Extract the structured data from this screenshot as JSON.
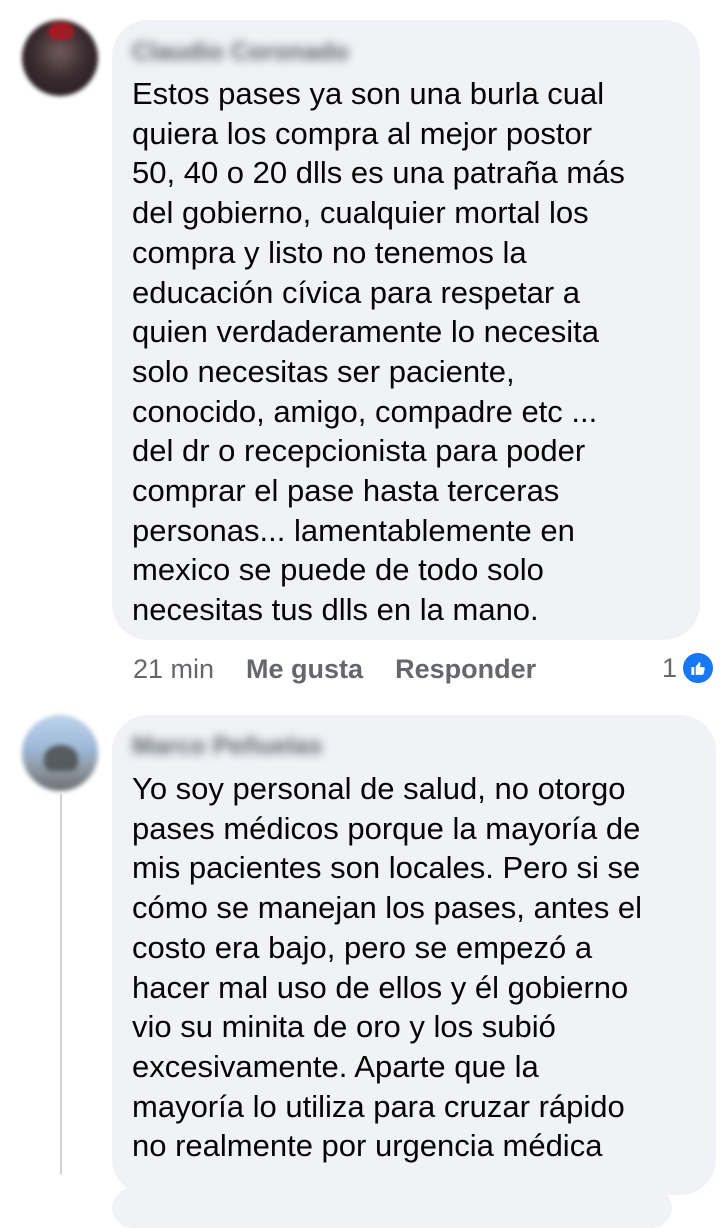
{
  "comments": [
    {
      "author": "Claudio Coronado",
      "text": "Estos pases ya son una burla cual\nquiera los compra al mejor postor\n50, 40 o 20 dlls es una patraña más\ndel gobierno, cualquier mortal los\ncompra y listo no tenemos la\neducación cívica para respetar a\nquien verdaderamente lo necesita\nsolo necesitas ser paciente,\nconocido, amigo, compadre etc ...\ndel dr o recepcionista para poder\ncomprar el pase hasta terceras\npersonas... lamentablemente en\nmexico se puede de todo solo\nnecesitas tus dlls en la mano.",
      "time": "21 min",
      "like_label": "Me gusta",
      "reply_label": "Responder",
      "reaction_count": "1",
      "reaction_icon": "like-icon",
      "reaction_color": "#1877f2"
    },
    {
      "author": "Marco Peñuelas",
      "text": "Yo soy personal de salud, no otorgo\npases médicos porque la mayoría de\nmis pacientes son locales. Pero si se\ncómo se manejan los pases, antes el\ncosto era bajo, pero se empezó a\nhacer mal uso de ellos y él gobierno\nvio su minita de oro y los subió\nexcesivamente. Aparte que la\nmayoría lo utiliza para cruzar rápido\nno realmente por urgencia médica"
    }
  ]
}
